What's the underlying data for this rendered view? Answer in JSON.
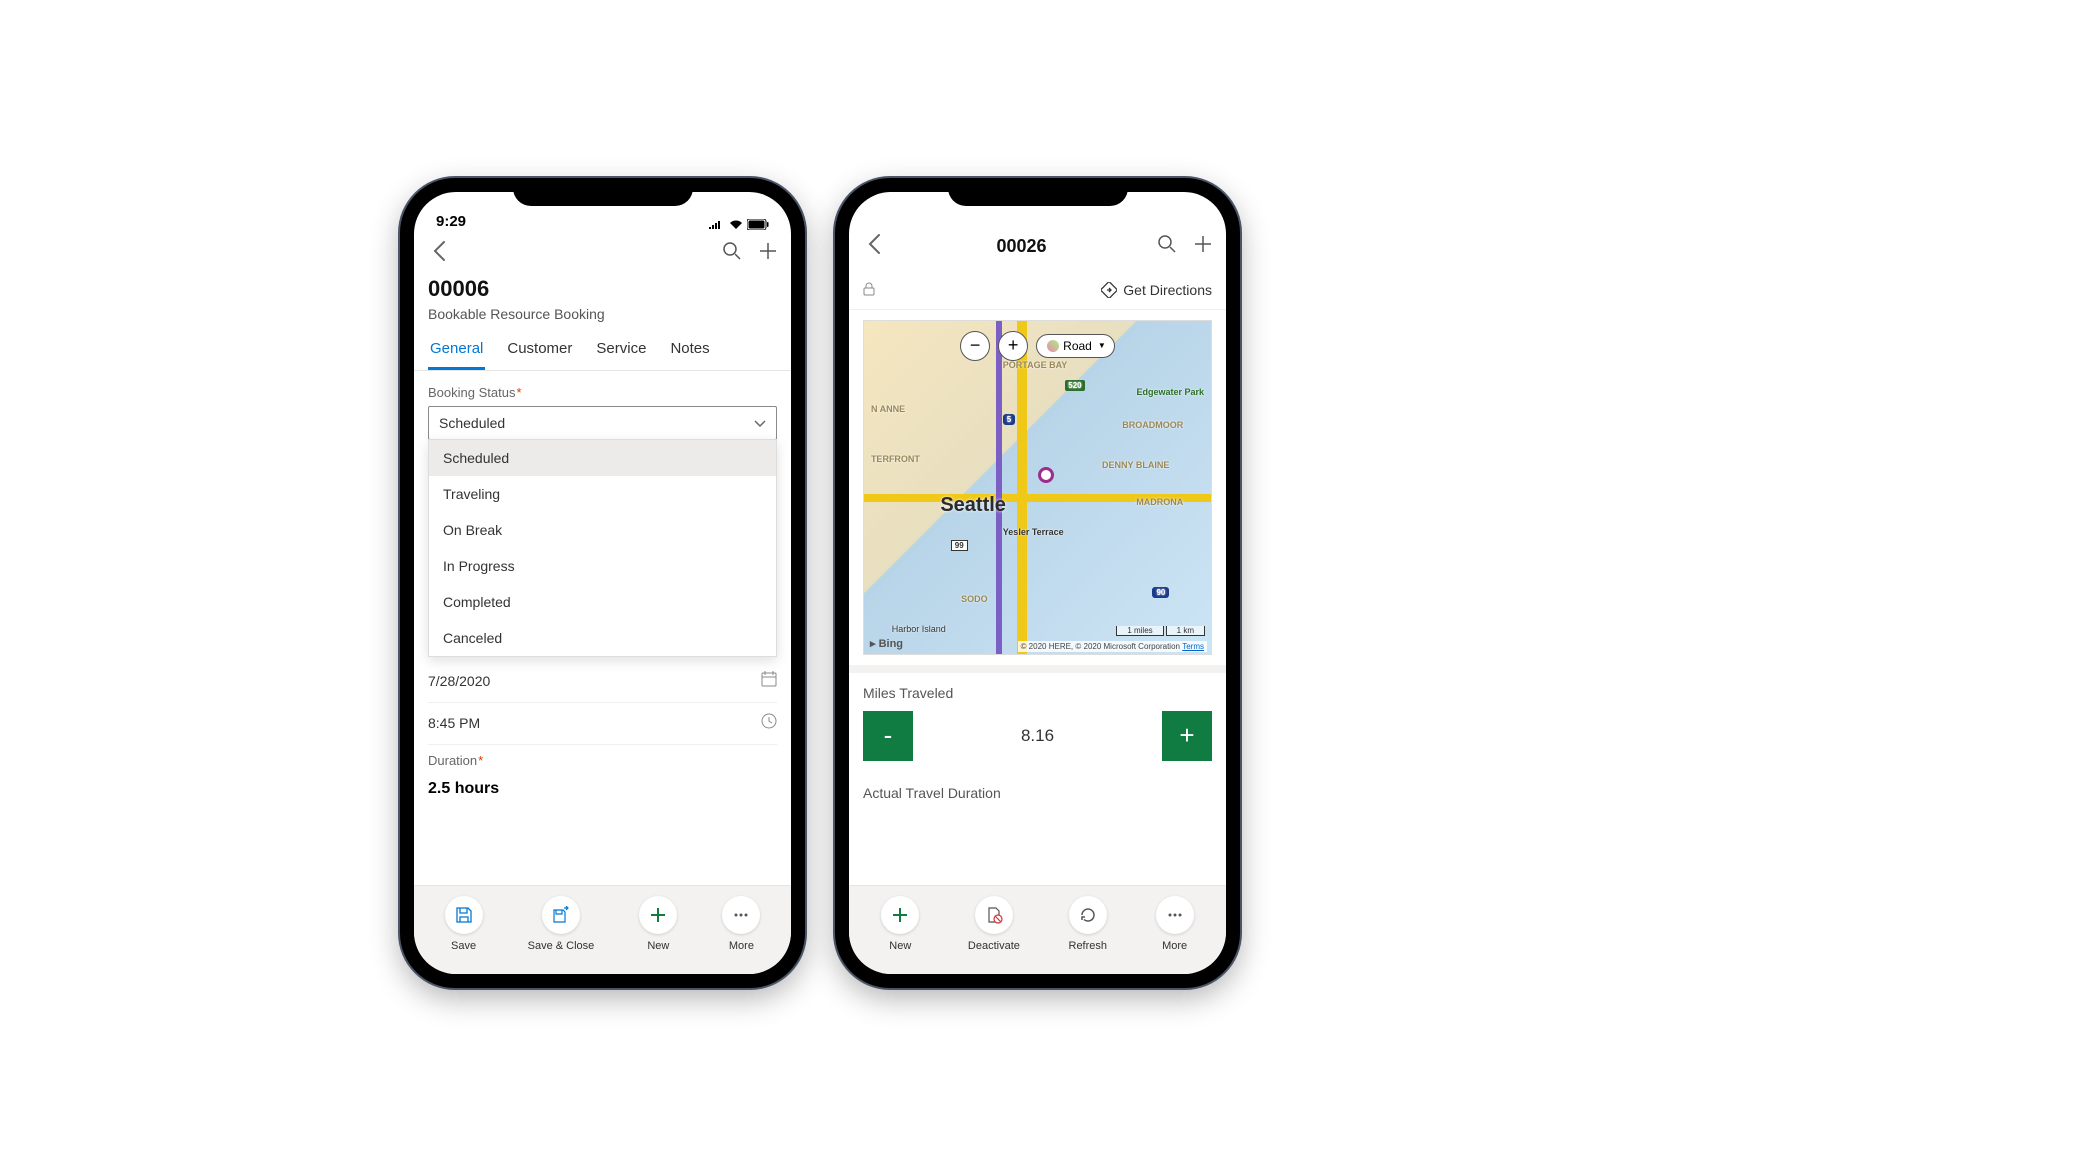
{
  "phone1": {
    "statusTime": "9:29",
    "recordId": "00006",
    "recordSubtitle": "Bookable Resource Booking",
    "tabs": [
      "General",
      "Customer",
      "Service",
      "Notes"
    ],
    "activeTab": 0,
    "bookingStatus": {
      "label": "Booking Status",
      "selected": "Scheduled",
      "options": [
        "Scheduled",
        "Traveling",
        "On Break",
        "In Progress",
        "Completed",
        "Canceled"
      ]
    },
    "dateValue": "7/28/2020",
    "timeValue": "8:45 PM",
    "duration": {
      "label": "Duration",
      "value": "2.5 hours"
    },
    "bottomBar": [
      {
        "name": "save",
        "label": "Save"
      },
      {
        "name": "save-close",
        "label": "Save & Close"
      },
      {
        "name": "new",
        "label": "New"
      },
      {
        "name": "more",
        "label": "More"
      }
    ]
  },
  "phone2": {
    "recordId": "00026",
    "getDirections": "Get Directions",
    "map": {
      "city": "Seattle",
      "typeLabel": "Road",
      "neighborhoods": {
        "portageBay": "PORTAGE BAY",
        "edgewater": "Edgewater Park",
        "broadmoor": "BROADMOOR",
        "dennyBlaine": "DENNY BLAINE",
        "madrona": "MADRONA",
        "yesler": "Yesler Terrace",
        "terfront": "TERFRONT",
        "anne": "N ANNE",
        "sodo": "SODO",
        "harbor": "Harbor Island"
      },
      "shields": {
        "i5": "5",
        "hwy520": "520",
        "hwy99": "99",
        "i90": "90"
      },
      "scale": {
        "miles": "1 miles",
        "km": "1 km"
      },
      "attribution": "© 2020 HERE, © 2020 Microsoft Corporation",
      "termsLabel": "Terms",
      "bing": "Bing"
    },
    "milesTraveled": {
      "label": "Miles Traveled",
      "value": "8.16"
    },
    "actualTravelDuration": {
      "label": "Actual Travel Duration"
    },
    "bottomBar": [
      {
        "name": "new",
        "label": "New"
      },
      {
        "name": "deactivate",
        "label": "Deactivate"
      },
      {
        "name": "refresh",
        "label": "Refresh"
      },
      {
        "name": "more",
        "label": "More"
      }
    ]
  }
}
